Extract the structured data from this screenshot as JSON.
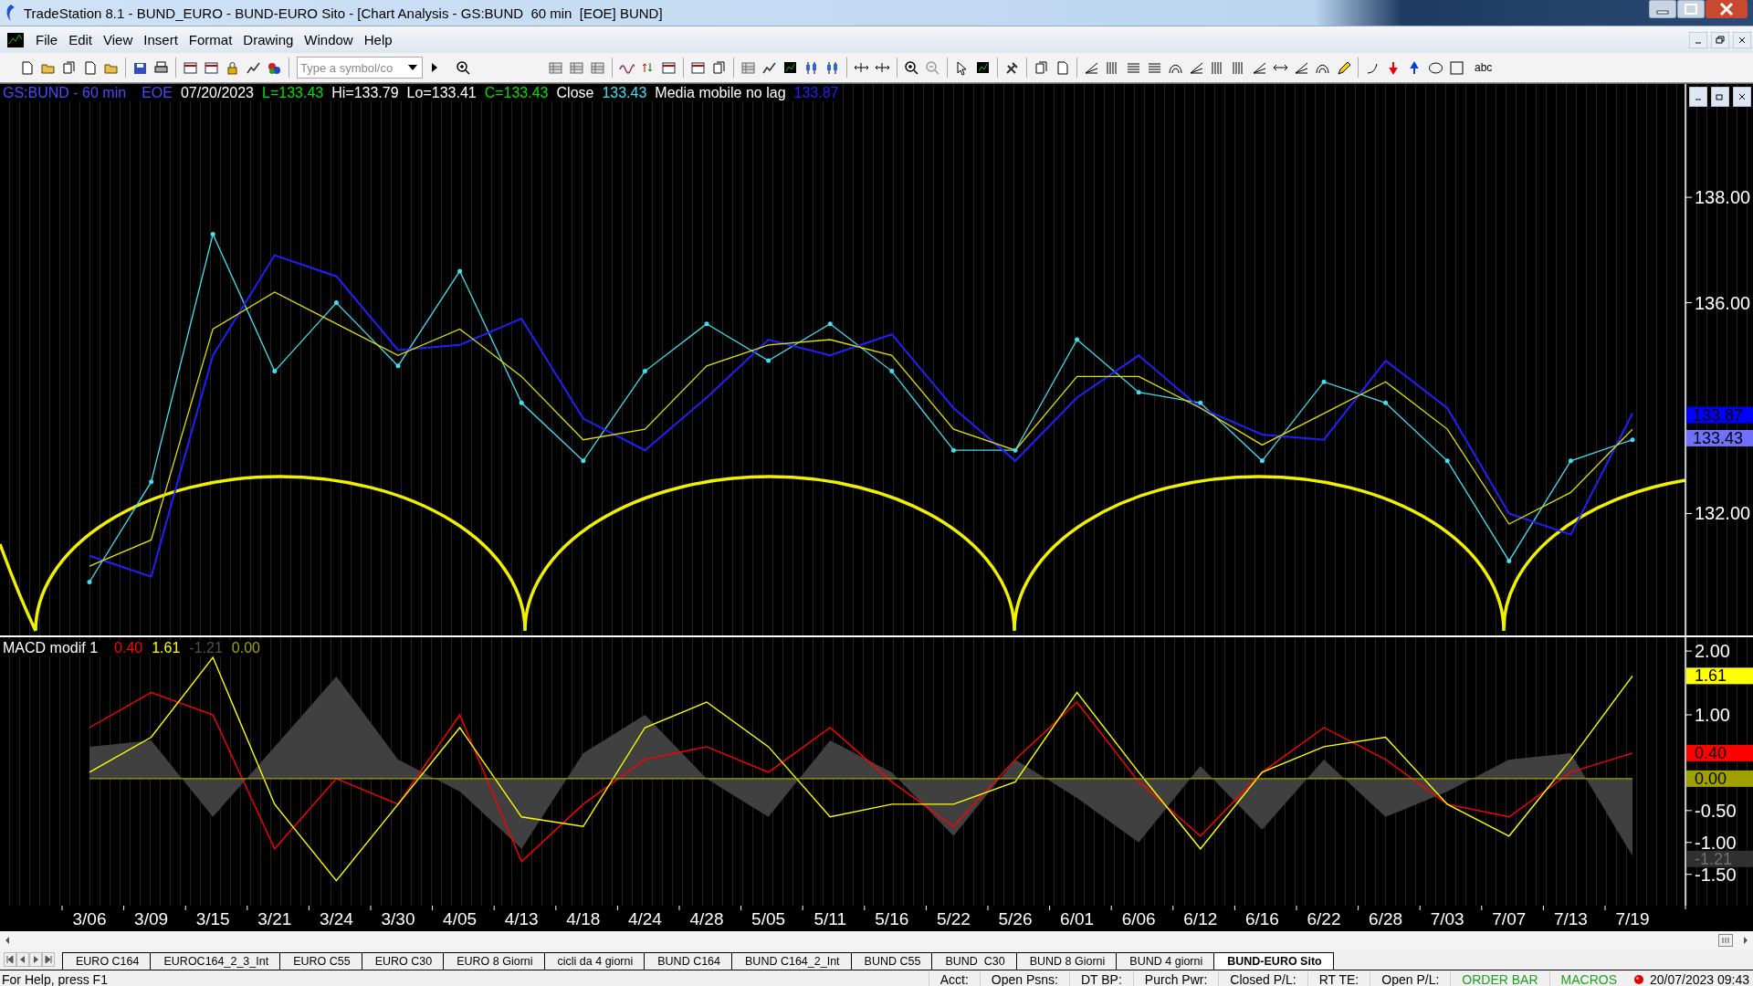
{
  "window": {
    "title": "TradeStation 8.1 - BUND_EURO - BUND-EURO Sito - [Chart Analysis - GS:BUND  60 min  [EOE] BUND]"
  },
  "menu": [
    {
      "label": "File"
    },
    {
      "label": "Edit"
    },
    {
      "label": "View"
    },
    {
      "label": "Insert"
    },
    {
      "label": "Format"
    },
    {
      "label": "Drawing"
    },
    {
      "label": "Window"
    },
    {
      "label": "Help"
    }
  ],
  "toolbar": {
    "symbol_field": {
      "placeholder": "Type a symbol/co"
    },
    "text_tool": "abc"
  },
  "price_legend": [
    {
      "text": "GS:BUND - 60 min",
      "color": "#4a4aff"
    },
    {
      "text": "EOE",
      "color": "#4a4aff"
    },
    {
      "text": "07/20/2023",
      "color": "#ffffff"
    },
    {
      "text": "L=133.43",
      "color": "#00e000"
    },
    {
      "text": "Hi=133.79",
      "color": "#ffffff"
    },
    {
      "text": "Lo=133.41",
      "color": "#ffffff"
    },
    {
      "text": "C=133.43",
      "color": "#00e000"
    },
    {
      "text": "Close",
      "color": "#ffffff"
    },
    {
      "text": "133.43",
      "color": "#40e0f0"
    },
    {
      "text": "Media mobile no lag",
      "color": "#ffffff"
    },
    {
      "text": "133.87",
      "color": "#2020ff"
    }
  ],
  "price_chart": {
    "chart_data": {
      "type": "line",
      "yticks": [
        {
          "value": 132,
          "label": "132.00"
        },
        {
          "value": 136,
          "label": "136.00"
        },
        {
          "value": 138,
          "label": "138.00"
        }
      ],
      "ylim": [
        129.67,
        140.15
      ],
      "series": [
        {
          "color": "#40e0f0",
          "values": [
            130.7,
            132.6,
            137.3,
            134.7,
            136.0,
            134.8,
            136.6,
            134.1,
            133.0,
            134.7,
            135.6,
            134.9,
            135.6,
            134.7,
            133.2,
            133.2,
            135.3,
            134.3,
            134.1,
            133.0,
            134.5,
            134.1,
            133.0,
            131.1,
            133.0,
            133.4
          ]
        },
        {
          "color": "#2020ff",
          "values": [
            131.2,
            130.8,
            135.0,
            136.9,
            136.5,
            135.1,
            135.2,
            135.7,
            133.8,
            133.2,
            134.2,
            135.3,
            135.0,
            135.4,
            134.0,
            133.0,
            134.2,
            135.0,
            134.0,
            133.5,
            133.4,
            134.9,
            134.0,
            132.0,
            131.6,
            133.9
          ]
        },
        {
          "color": "#e0e000",
          "values": [
            131.0,
            131.5,
            135.5,
            136.2,
            135.6,
            135.0,
            135.5,
            134.6,
            133.4,
            133.6,
            134.8,
            135.2,
            135.3,
            135.0,
            133.6,
            133.2,
            134.6,
            134.6,
            134.0,
            133.3,
            133.9,
            134.5,
            133.6,
            131.8,
            132.4,
            133.6
          ]
        }
      ]
    }
  },
  "price_tags": [
    {
      "text": "133.87",
      "color": "#0000ff"
    },
    {
      "text": "133.43",
      "color": "#7070ff"
    }
  ],
  "macd_legend": [
    {
      "text": "MACD modif 1",
      "color": "#ffffff"
    },
    {
      "text": "0.40",
      "color": "#ff0000"
    },
    {
      "text": "1.61",
      "color": "#ffff00"
    },
    {
      "text": "-1.21",
      "color": "#505050"
    },
    {
      "text": "0.00",
      "color": "#a0a000"
    }
  ],
  "macd_chart": {
    "chart_data": {
      "type": "line",
      "categories": [
        "3/06",
        "3/09",
        "3/15",
        "3/21",
        "3/24",
        "3/30",
        "4/05",
        "4/13",
        "4/18",
        "4/24",
        "4/28",
        "5/05",
        "5/11",
        "5/16",
        "5/22",
        "5/26",
        "6/01",
        "6/06",
        "6/12",
        "6/16",
        "6/22",
        "6/28",
        "7/03",
        "7/07",
        "7/13",
        "7/19"
      ],
      "yticks": [
        {
          "value": -1.5,
          "label": "-1.50"
        },
        {
          "value": -1,
          "label": "-1.00"
        },
        {
          "value": -0.5,
          "label": "-0.50"
        },
        {
          "value": 1,
          "label": "1.00"
        },
        {
          "value": 2,
          "label": "2.00"
        }
      ],
      "ylim": [
        -1.99,
        2.23
      ],
      "series": [
        {
          "color": "#404040",
          "type": "area",
          "values": [
            0.5,
            0.6,
            -0.6,
            0.5,
            1.6,
            0.3,
            -0.2,
            -1.1,
            0.4,
            1.0,
            0.0,
            -0.6,
            0.6,
            0.1,
            -0.9,
            0.3,
            -0.3,
            -1.0,
            0.2,
            -0.8,
            0.3,
            -0.6,
            -0.2,
            0.3,
            0.4,
            -1.21
          ]
        },
        {
          "color": "#ff0000",
          "type": "line",
          "values": [
            0.8,
            1.35,
            1.0,
            -1.1,
            0.0,
            -0.4,
            1.0,
            -1.3,
            -0.4,
            0.3,
            0.5,
            0.1,
            0.8,
            -0.05,
            -0.75,
            0.3,
            1.2,
            -0.05,
            -0.9,
            0.1,
            0.8,
            0.3,
            -0.4,
            -0.6,
            0.1,
            0.4
          ]
        },
        {
          "color": "#ffff00",
          "type": "line",
          "values": [
            0.1,
            0.65,
            1.9,
            -0.4,
            -1.6,
            -0.4,
            0.8,
            -0.6,
            -0.75,
            0.8,
            1.2,
            0.5,
            -0.6,
            -0.4,
            -0.4,
            -0.05,
            1.35,
            0.1,
            -1.1,
            0.1,
            0.5,
            0.65,
            -0.4,
            -0.9,
            0.3,
            1.61
          ]
        },
        {
          "color": "#a0a000",
          "type": "line",
          "values": [
            0,
            0,
            0,
            0,
            0,
            0,
            0,
            0,
            0,
            0,
            0,
            0,
            0,
            0,
            0,
            0,
            0,
            0,
            0,
            0,
            0,
            0,
            0,
            0,
            0,
            0
          ]
        }
      ]
    }
  },
  "macd_tags": [
    {
      "text": "1.61",
      "color": "#ffff00"
    },
    {
      "text": "0.40",
      "color": "#ff0000"
    },
    {
      "text": "0.00",
      "color": "#a0a000"
    },
    {
      "text": "-1.21",
      "color": "#303030"
    }
  ],
  "tabs": [
    {
      "label": "EURO C164",
      "selected": false
    },
    {
      "label": "EUROC164_2_3_Int",
      "selected": false
    },
    {
      "label": "EURO C55",
      "selected": false
    },
    {
      "label": "EURO C30",
      "selected": false
    },
    {
      "label": "EURO 8 Giorni",
      "selected": false
    },
    {
      "label": "cicli da 4 giorni",
      "selected": false
    },
    {
      "label": "BUND C164",
      "selected": false
    },
    {
      "label": "BUND C164_2_Int",
      "selected": false
    },
    {
      "label": "BUND C55",
      "selected": false
    },
    {
      "label": "BUND  C30",
      "selected": false
    },
    {
      "label": "BUND 8 Giorni",
      "selected": false
    },
    {
      "label": "BUND 4 giorni",
      "selected": false
    },
    {
      "label": "BUND-EURO Sito",
      "selected": true
    }
  ],
  "status_bar": {
    "help": "For Help, press F1",
    "fields": [
      {
        "text": "Acct:",
        "color": "#000000"
      },
      {
        "text": "Open Psns:",
        "color": "#000000"
      },
      {
        "text": "DT BP:",
        "color": "#000000"
      },
      {
        "text": "Purch Pwr:",
        "color": "#000000"
      },
      {
        "text": "Closed P/L:",
        "color": "#000000"
      },
      {
        "text": "RT TE:",
        "color": "#000000"
      },
      {
        "text": "Open P/L:",
        "color": "#000000"
      },
      {
        "text": "ORDER BAR",
        "color": "#20a020"
      },
      {
        "text": "MACROS",
        "color": "#20a020"
      }
    ],
    "clock": "20/07/2023 09:43"
  }
}
